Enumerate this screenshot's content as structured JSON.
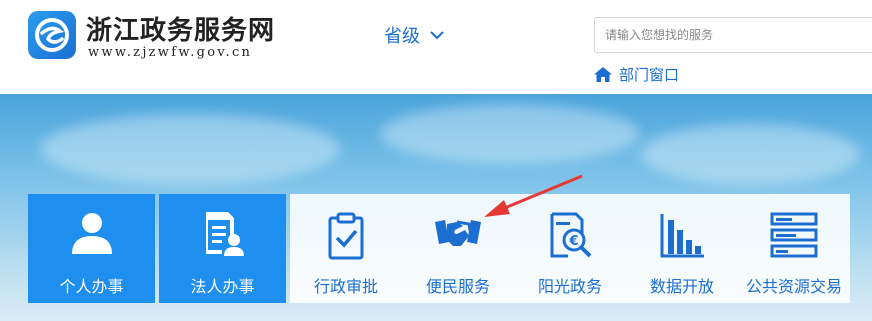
{
  "header": {
    "site_title": "浙江政务服务网",
    "site_url": "www.zjzwfw.gov.cn",
    "region_label": "省级",
    "search": {
      "placeholder": "请输入您想找的服务",
      "value": ""
    },
    "dept_link": "部门窗口"
  },
  "portals": [
    {
      "label": "个人办事",
      "icon": "person-icon"
    },
    {
      "label": "法人办事",
      "icon": "corporate-doc-icon"
    }
  ],
  "services": [
    {
      "label": "行政审批",
      "icon": "clipboard-check-icon"
    },
    {
      "label": "便民服务",
      "icon": "handshake-icon"
    },
    {
      "label": "阳光政务",
      "icon": "transparency-report-icon"
    },
    {
      "label": "数据开放",
      "icon": "bar-chart-icon"
    },
    {
      "label": "公共资源交易",
      "icon": "server-stack-icon"
    }
  ],
  "colors": {
    "primary": "#1e8fef",
    "link": "#1c6fd0",
    "arrow": "#e53935"
  },
  "annotation": {
    "target": "便民服务",
    "icon": "red-arrow-icon"
  }
}
